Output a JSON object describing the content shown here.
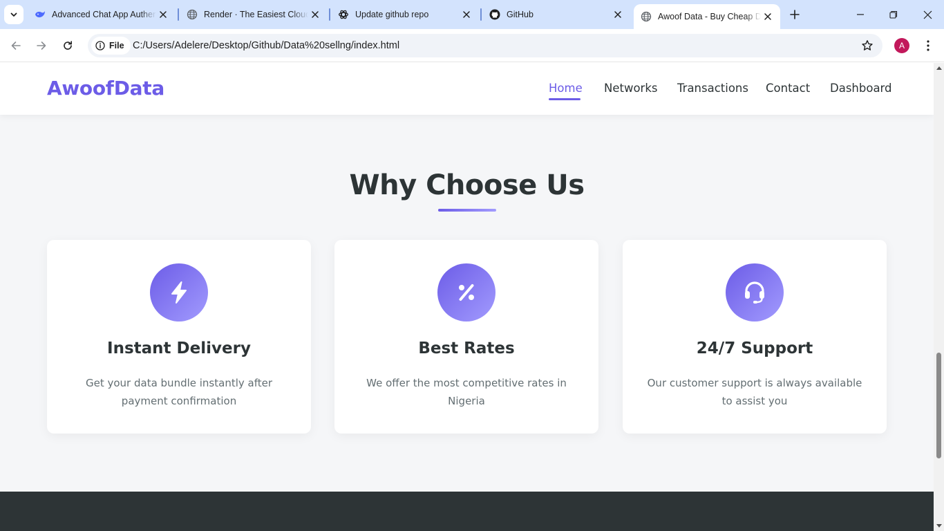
{
  "browser": {
    "tabs": [
      {
        "title": "Advanced Chat App Authenti",
        "favicon": "whale-icon",
        "active": false
      },
      {
        "title": "Render · The Easiest Cloud P",
        "favicon": "globe-icon",
        "active": false
      },
      {
        "title": "Update github repo",
        "favicon": "openai-icon",
        "active": false
      },
      {
        "title": "GitHub",
        "favicon": "github-icon",
        "active": false
      },
      {
        "title": "Awoof Data - Buy Cheap Da",
        "favicon": "globe-icon",
        "active": true
      }
    ],
    "address": {
      "scheme_chip": "File",
      "url": "C:/Users/Adelere/Desktop/Github/Data%20sellng/index.html"
    },
    "profile_initial": "A",
    "colors": {
      "tabstrip": "#d3e3fd",
      "profile": "#c2185b"
    }
  },
  "site": {
    "logo": "AwoofData",
    "nav": [
      {
        "label": "Home",
        "active": true
      },
      {
        "label": "Networks",
        "active": false
      },
      {
        "label": "Transactions",
        "active": false
      },
      {
        "label": "Contact",
        "active": false
      },
      {
        "label": "Dashboard",
        "active": false
      }
    ],
    "section_title": "Why Choose Us",
    "features": [
      {
        "icon": "bolt-icon",
        "title": "Instant Delivery",
        "desc_line1": "Get your data bundle instantly after",
        "desc_line2": "payment confirmation"
      },
      {
        "icon": "percent-icon",
        "title": "Best Rates",
        "desc_line1": "We offer the most competitive rates in",
        "desc_line2": "Nigeria"
      },
      {
        "icon": "headset-icon",
        "title": "24/7 Support",
        "desc_line1": "Our customer support is always available",
        "desc_line2": "to assist you"
      }
    ],
    "colors": {
      "primary": "#6c5ce7",
      "primary_light": "#a29bfe",
      "text_dark": "#2d3436",
      "text_muted": "#636e72",
      "footer": "#2d3436"
    }
  }
}
